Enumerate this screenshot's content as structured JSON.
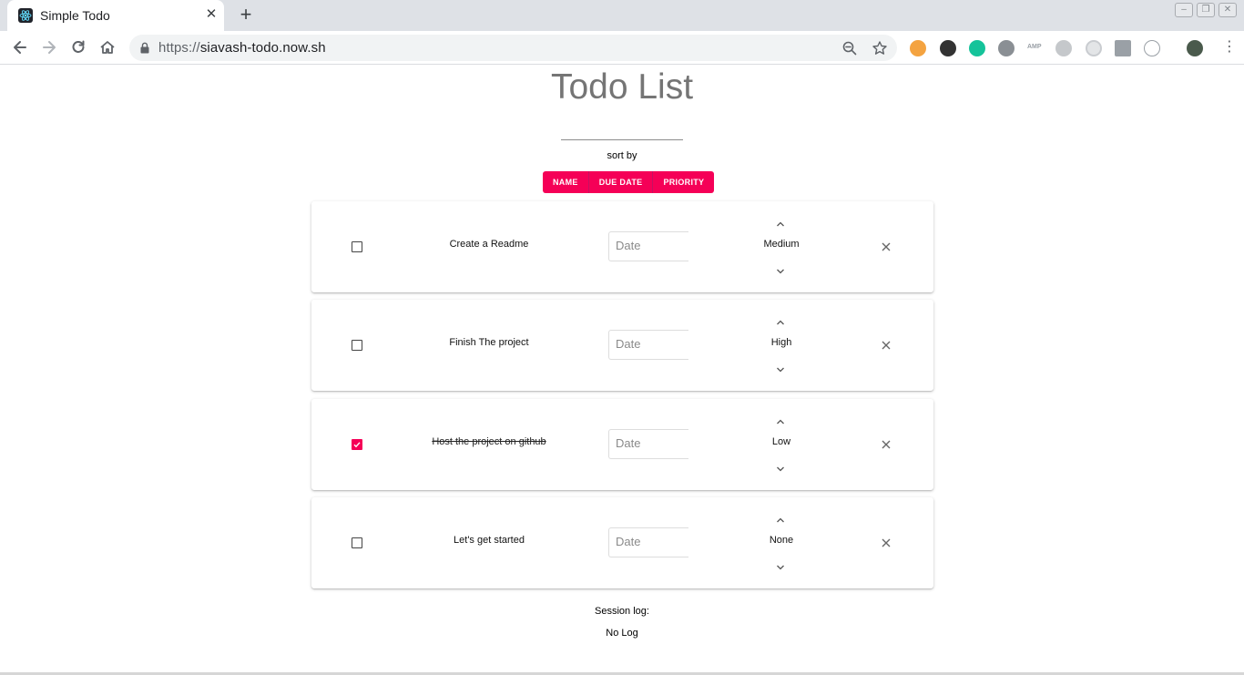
{
  "browser": {
    "tab_title": "Simple Todo",
    "url_scheme": "https://",
    "url_host": "siavash-todo.now.sh",
    "extension_labels": {
      "amp": "AMP"
    }
  },
  "page": {
    "title": "Todo List",
    "new_todo_value": "",
    "sort_label": "sort by",
    "sort_buttons": [
      "NAME",
      "DUE DATE",
      "PRIORITY"
    ],
    "accent_color": "#f50057",
    "todos": [
      {
        "name": "Create a Readme",
        "done": false,
        "date_placeholder": "Date",
        "priority": "Medium"
      },
      {
        "name": "Finish The project",
        "done": false,
        "date_placeholder": "Date",
        "priority": "High"
      },
      {
        "name": "Host the project on github",
        "done": true,
        "date_placeholder": "Date",
        "priority": "Low"
      },
      {
        "name": "Let's get started",
        "done": false,
        "date_placeholder": "Date",
        "priority": "None"
      }
    ],
    "session_label": "Session log:",
    "session_value": "No Log"
  },
  "icons": {
    "back": "back-arrow-icon",
    "forward": "forward-arrow-icon",
    "reload": "reload-icon",
    "home": "home-icon",
    "lock": "lock-icon",
    "zoom": "zoom-out-icon",
    "star": "star-icon",
    "checkbox_unchecked": "checkbox-icon",
    "checkbox_checked": "checkbox-checked-icon",
    "up": "chevron-up-icon",
    "down": "chevron-down-icon",
    "delete": "close-icon"
  }
}
